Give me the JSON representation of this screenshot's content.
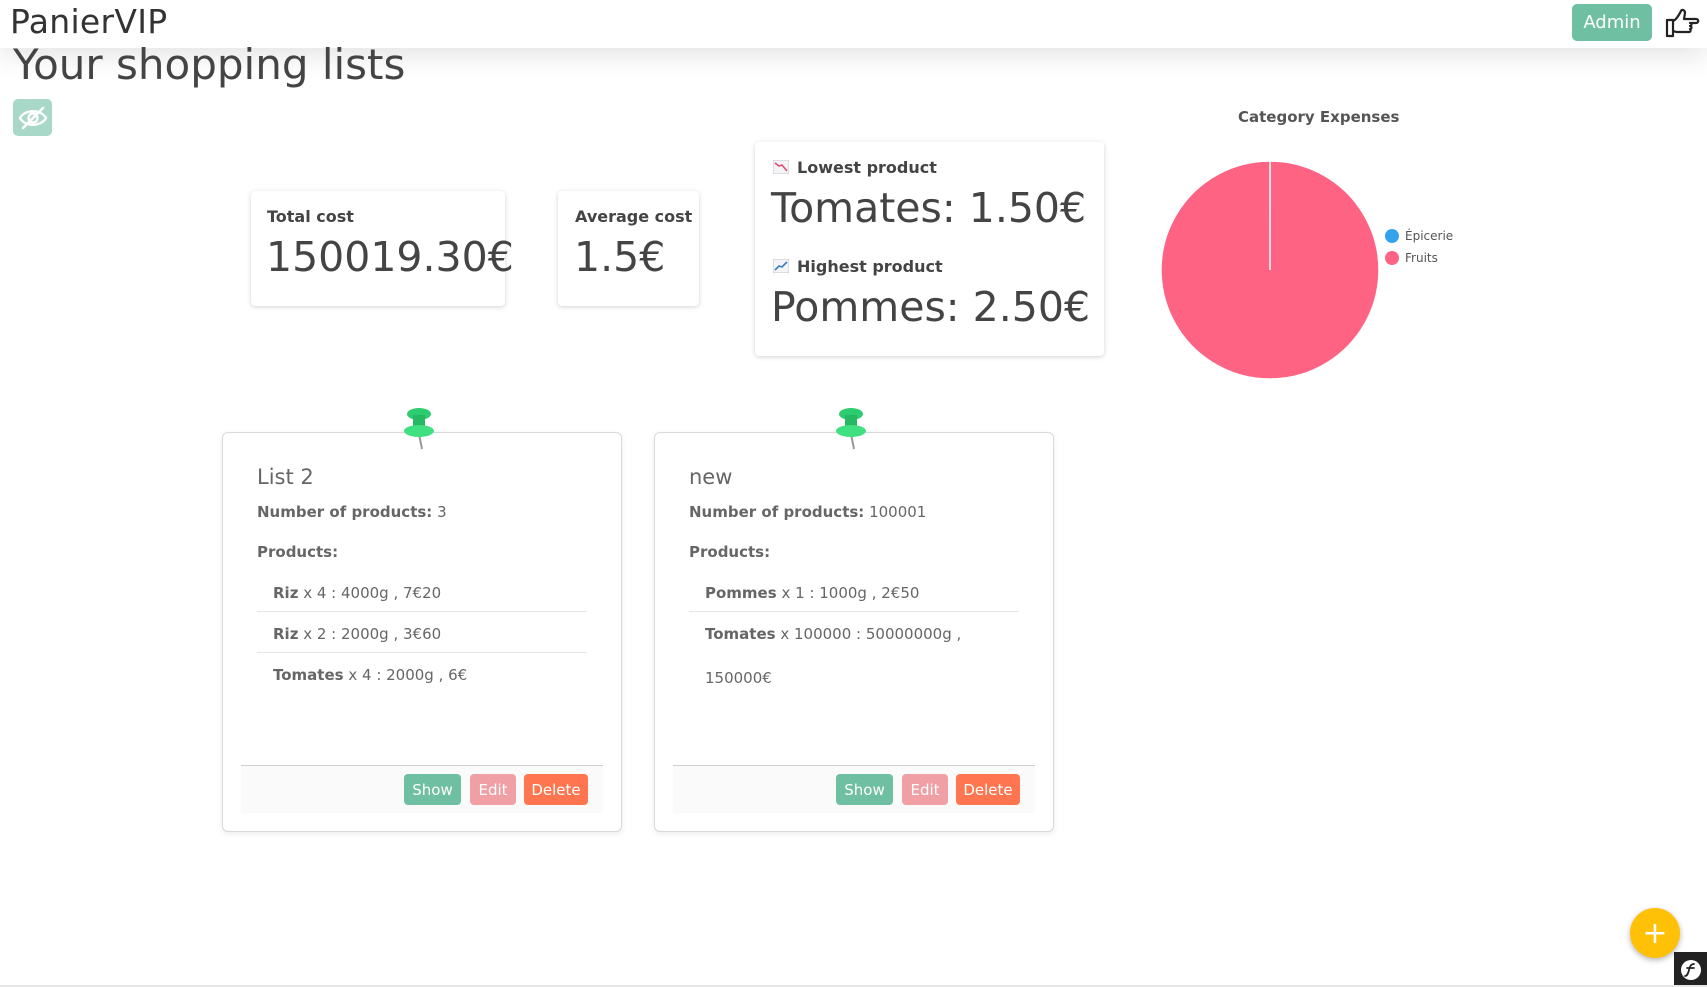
{
  "app": {
    "brand": "PanierVIP"
  },
  "header": {
    "admin_label": "Admin",
    "logout_icon": "hand-pointing-right-icon"
  },
  "page": {
    "title": "Your shopping lists",
    "toggle_visibility_icon": "eye-slash-icon"
  },
  "stats": {
    "total_cost": {
      "label": "Total cost",
      "value": "150019.30€"
    },
    "average_cost": {
      "label": "Average cost",
      "value": "1.5€"
    },
    "lowest": {
      "label": "Lowest product",
      "value": "Tomates: 1.50€",
      "icon": "chart-decreasing-icon"
    },
    "highest": {
      "label": "Highest product",
      "value": "Pommes: 2.50€",
      "icon": "chart-increasing-icon"
    }
  },
  "chart_data": {
    "type": "pie",
    "title": "Category Expenses",
    "labels": [
      "Épicerie",
      "Fruits"
    ],
    "values": [
      19.3,
      150002.5
    ],
    "colors": [
      "#36a2eb",
      "#ff6384"
    ],
    "legend": "right"
  },
  "lists": [
    {
      "name": "List 2",
      "count_label": "Number of products:",
      "count": "3",
      "products_label": "Products:",
      "products": [
        {
          "name": "Riz",
          "detail": "x 4 : 4000g , 7€20"
        },
        {
          "name": "Riz",
          "detail": "x 2 : 2000g , 3€60"
        },
        {
          "name": "Tomates",
          "detail": "x 4 : 2000g , 6€"
        }
      ],
      "show_label": "Show",
      "edit_label": "Edit",
      "delete_label": "Delete"
    },
    {
      "name": "new",
      "count_label": "Number of products:",
      "count": "100001",
      "products_label": "Products:",
      "products": [
        {
          "name": "Pommes",
          "detail": "x 1 : 1000g , 2€50"
        },
        {
          "name": "Tomates",
          "detail": "x 100000 : 50000000g , 150000€"
        }
      ],
      "show_label": "Show",
      "edit_label": "Edit",
      "delete_label": "Delete"
    }
  ],
  "fab": {
    "label": "+"
  },
  "colors": {
    "primary": "#6fbfa3",
    "danger": "#ff7550",
    "edit": "#f0a0a4",
    "fab": "#ffc107"
  }
}
